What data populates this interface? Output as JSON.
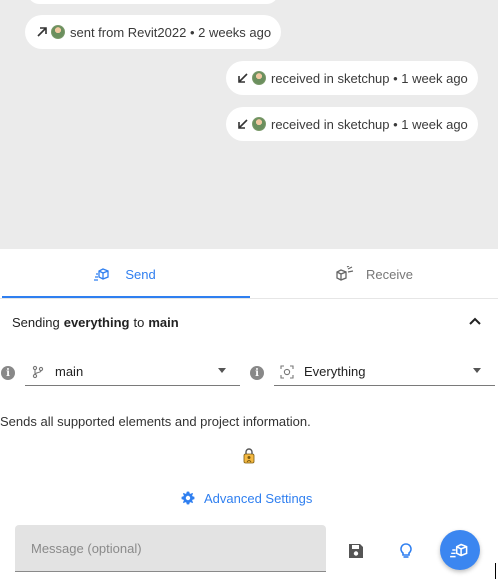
{
  "timeline": {
    "activities": [
      {
        "direction": "sent",
        "icon": "arrow-up-right-icon",
        "text": "sent from Revit2022 • 2 weeks ago"
      },
      {
        "direction": "received",
        "icon": "arrow-down-left-icon",
        "text": "received in sketchup • 1 week ago"
      },
      {
        "direction": "received",
        "icon": "arrow-down-left-icon",
        "text": "received in sketchup • 1 week ago"
      }
    ]
  },
  "tabs": {
    "send_label": "Send",
    "receive_label": "Receive",
    "active": "Send"
  },
  "summary": {
    "prefix": "Sending",
    "filter": "everything",
    "connector": "to",
    "branch": "main"
  },
  "branch_select": {
    "value": "main",
    "icon": "branch-icon"
  },
  "filter_select": {
    "value": "Everything",
    "icon": "select-all-icon"
  },
  "description": "Sends all supported elements and project information.",
  "advanced_settings_label": "Advanced Settings",
  "message": {
    "placeholder": "Message (optional)"
  },
  "colors": {
    "accent": "#2f7ff0",
    "timeline_bg": "#ebebeb",
    "fab": "#3b86f0"
  }
}
